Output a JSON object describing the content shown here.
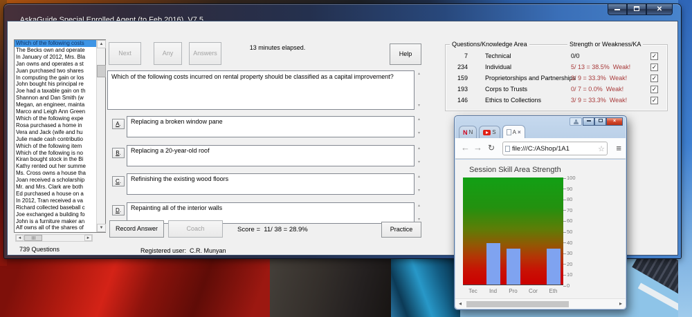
{
  "app": {
    "title": "AskaGuide Special Enrolled Agent (to Feb 2016)  V7.5",
    "question_list": {
      "count_label": "739 Questions",
      "selected_index": 0,
      "items": [
        "Which of the following costs",
        "The Becks own and operate",
        "In January of 2012, Mrs. Bla",
        "Jan owns and operates a st",
        "Juan purchased two shares",
        "In computing the gain or los",
        "John bought his principal re",
        "Joe had a taxable gain on th",
        "Shannon and Dan Smith (w",
        "Megan, an engineer, mainta",
        "Marco and Leigh Ann Green",
        "Which of the following expe",
        "Rosa purchased a home in",
        "Vera and Jack (wife and hu",
        "Julie made cash contributio",
        "Which of the following item",
        "Which of the following is no",
        "Kiran bought stock in the Bi",
        "Kathy rented out her summe",
        "Ms. Cross owns a house tha",
        "Joan received a scholarship",
        "Mr. and Mrs. Clark are both",
        "Ed purchased a house on a",
        "In 2012, Tran received a va",
        "Richard collected baseball c",
        "Joe exchanged a building fo",
        "John is a furniture maker an",
        "Alf owns all of the shares of"
      ]
    },
    "toolbar": {
      "next": "Next",
      "any": "Any",
      "answers": "Answers",
      "elapsed": "13 minutes elapsed.",
      "help": "Help"
    },
    "question": "Which of the following costs incurred on rental property should be classified as a capital improvement?",
    "answer_key_suffix": ".",
    "answers": [
      {
        "key": "A",
        "text": "Replacing a broken window pane"
      },
      {
        "key": "B",
        "text": "Replacing a 20-year-old roof"
      },
      {
        "key": "C",
        "text": "Refinishing the existing wood floors"
      },
      {
        "key": "D",
        "text": "Repainting all of the interior walls"
      }
    ],
    "footer": {
      "record": "Record Answer",
      "coach": "Coach",
      "score": "Score =  11/ 38 = 28.9%",
      "practice": "Practice",
      "registered": "Registered user:  C.R. Munyan"
    },
    "knowledge_panel": {
      "title_left": "Questions/Knowledge Area",
      "title_right": "Strength or Weakness/KA",
      "rows": [
        {
          "count": "7",
          "area": "Technical",
          "strength": "0/0",
          "weak": false,
          "checked": true
        },
        {
          "count": "234",
          "area": "Individual",
          "strength": "5/ 13 = 38.5%  Weak!",
          "weak": true,
          "checked": true
        },
        {
          "count": "159",
          "area": "Proprietorships and Partnerships",
          "strength": "3/ 9 = 33.3%  Weak!",
          "weak": true,
          "checked": true
        },
        {
          "count": "193",
          "area": "Corps to Trusts",
          "strength": "0/ 7 = 0.0%  Weak!",
          "weak": true,
          "checked": true
        },
        {
          "count": "146",
          "area": "Ethics to Collections",
          "strength": "3/ 9 = 33.3%  Weak!",
          "weak": true,
          "checked": true
        }
      ]
    }
  },
  "browser": {
    "tabs": [
      {
        "label": "N",
        "icon": "netflix"
      },
      {
        "label": "S",
        "icon": "youtube"
      },
      {
        "label": "A",
        "icon": "file",
        "active": true
      }
    ],
    "url": "file:///C:/AShop/1A1",
    "chart_title": "Session Skill Area Strength"
  },
  "chart_data": {
    "type": "bar",
    "title": "Session Skill Area Strength",
    "categories": [
      "Tec",
      "Ind",
      "Pro",
      "Cor",
      "Eth"
    ],
    "values": [
      0,
      38.5,
      33.3,
      0,
      33.3
    ],
    "xlabel": "",
    "ylabel": "",
    "ylim": [
      0,
      100
    ],
    "yticks": [
      0,
      10,
      20,
      30,
      40,
      50,
      60,
      70,
      80,
      90,
      100
    ],
    "grid": false,
    "legend": "none",
    "bar_color": "#7fa3f0",
    "plot_bg_top": "#12a015",
    "plot_bg_bottom": "#cb0000"
  },
  "colors": {
    "weak_text": "#a83a3a",
    "selection_bg": "#3e95e5",
    "title_bar_left": "#47303a",
    "title_bar_right": "#4884cc"
  },
  "icons": {
    "scroll_up": "▲",
    "scroll_down": "▼",
    "scroll_left": "◄",
    "scroll_right": "►",
    "small_up": "▴",
    "small_down": "▾",
    "small_left": "◂",
    "small_right": "▸",
    "back": "←",
    "forward": "→",
    "reload": "↻",
    "star": "☆",
    "menu": "≡",
    "close": "×",
    "check": "✓"
  }
}
